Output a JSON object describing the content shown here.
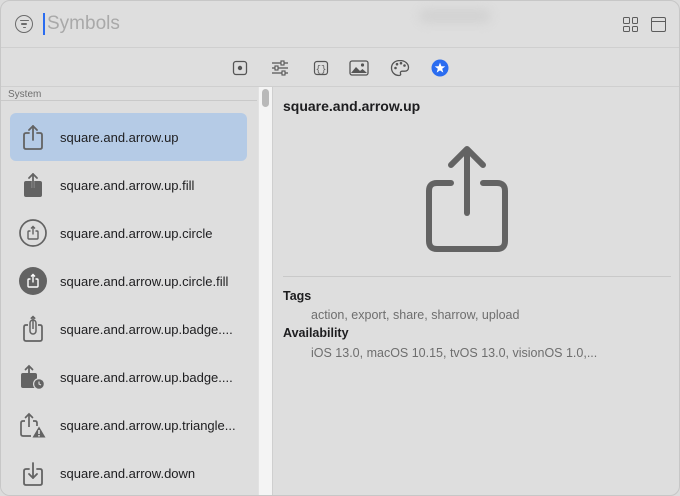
{
  "search": {
    "placeholder": "Symbols",
    "value": ""
  },
  "toolbar": {
    "buttons": [
      {
        "name": "symbol-view-icon"
      },
      {
        "name": "sliders-icon"
      },
      {
        "name": "curly-braces-icon"
      },
      {
        "name": "image-icon"
      },
      {
        "name": "palette-icon"
      },
      {
        "name": "star-circle-icon"
      }
    ]
  },
  "sidebar": {
    "section": "System",
    "items": [
      {
        "label": "square.and.arrow.up",
        "icon": "square-and-arrow-up-icon",
        "selected": true
      },
      {
        "label": "square.and.arrow.up.fill",
        "icon": "square-and-arrow-up-fill-icon"
      },
      {
        "label": "square.and.arrow.up.circle",
        "icon": "square-and-arrow-up-circle-icon"
      },
      {
        "label": "square.and.arrow.up.circle.fill",
        "icon": "square-and-arrow-up-circle-fill-icon"
      },
      {
        "label": "square.and.arrow.up.badge....",
        "icon": "square-and-arrow-up-badge-icon"
      },
      {
        "label": "square.and.arrow.up.badge....",
        "icon": "square-and-arrow-up-badge-clock-icon"
      },
      {
        "label": "square.and.arrow.up.triangle...",
        "icon": "square-and-arrow-up-triangle-icon"
      },
      {
        "label": "square.and.arrow.down",
        "icon": "square-and-arrow-down-icon"
      }
    ]
  },
  "detail": {
    "title": "square.and.arrow.up",
    "preview_icon": "square-and-arrow-up-icon",
    "tags_label": "Tags",
    "tags": "action, export, share, sharrow, upload",
    "availability_label": "Availability",
    "availability": "iOS 13.0, macOS 10.15, tvOS 13.0, visionOS 1.0,..."
  },
  "colors": {
    "selection": "#b5cbe6",
    "accent": "#2a6cf0",
    "icon": "#636363"
  }
}
